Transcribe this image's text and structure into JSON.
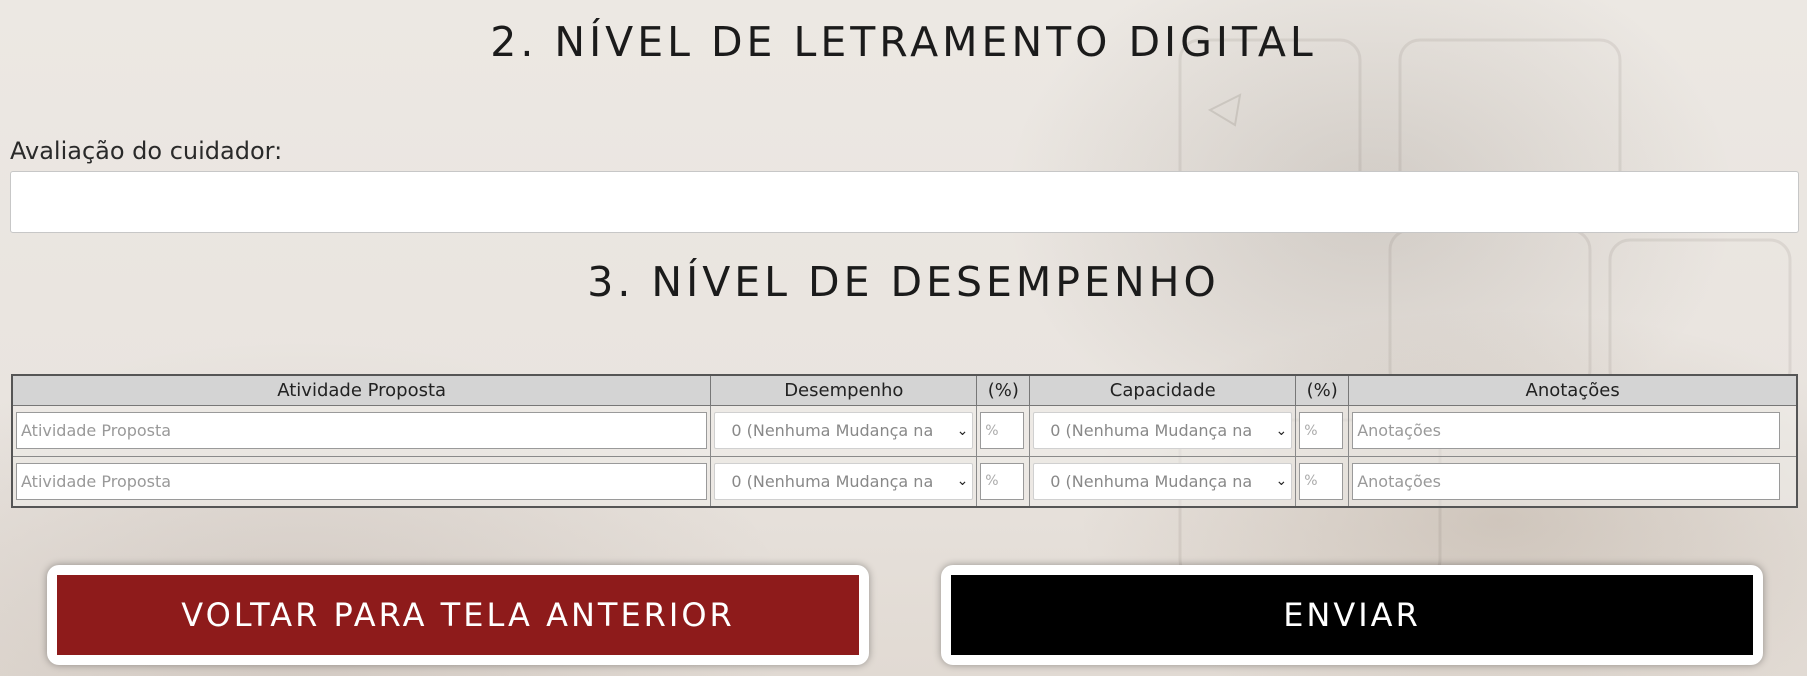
{
  "sections": {
    "literacy_title": "2. NÍVEL DE LETRAMENTO DIGITAL",
    "performance_title": "3. NÍVEL DE DESEMPENHO"
  },
  "caregiver": {
    "label": "Avaliação do cuidador:",
    "value": ""
  },
  "table": {
    "headers": [
      "Atividade Proposta",
      "Desempenho",
      "(%)",
      "Capacidade",
      "(%)",
      "Anotações"
    ],
    "rows": [
      {
        "activity_placeholder": "Atividade Proposta",
        "performance_value": "0 (Nenhuma Mudança na",
        "performance_pct_placeholder": "%",
        "capacity_value": "0 (Nenhuma Mudança na",
        "capacity_pct_placeholder": "%",
        "notes_placeholder": "Anotações"
      },
      {
        "activity_placeholder": "Atividade Proposta",
        "performance_value": "0 (Nenhuma Mudança na",
        "performance_pct_placeholder": "%",
        "capacity_value": "0 (Nenhuma Mudança na",
        "capacity_pct_placeholder": "%",
        "notes_placeholder": "Anotações"
      }
    ]
  },
  "buttons": {
    "back_label": "VOLTAR PARA TELA ANTERIOR",
    "send_label": "ENVIAR"
  },
  "colors": {
    "back_button": "#8e1b1b",
    "send_button": "#000000"
  },
  "icons": {
    "select_chevron": "chevron-down-icon"
  }
}
